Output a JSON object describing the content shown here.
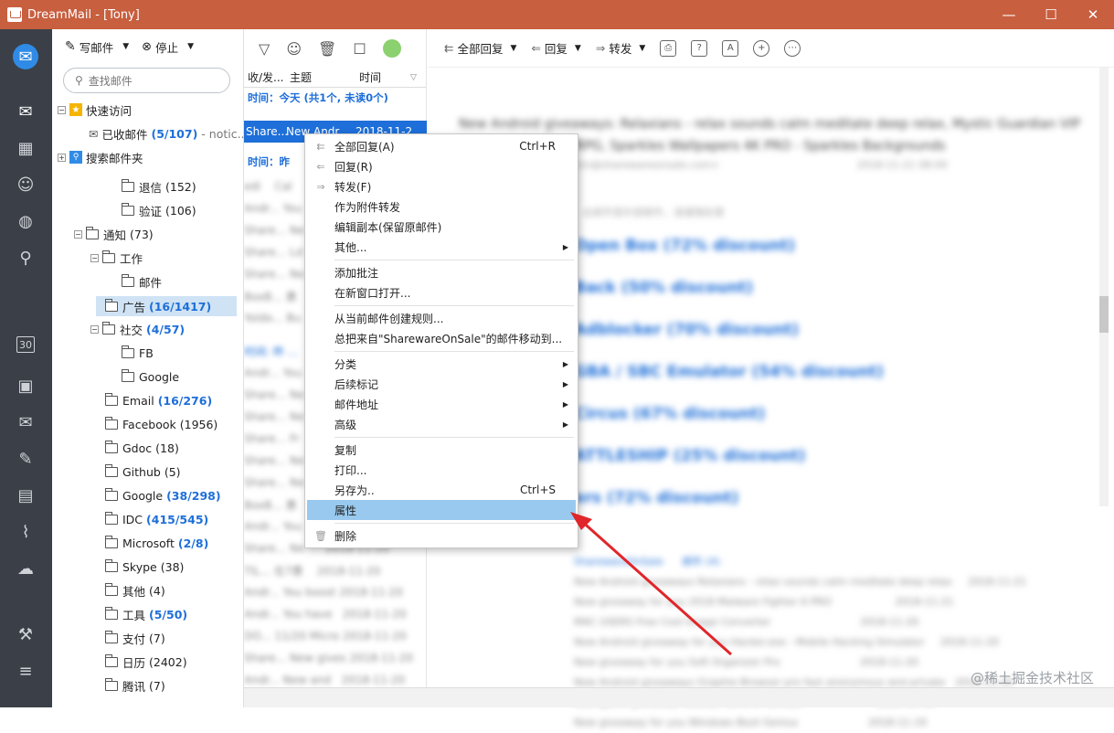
{
  "window": {
    "title": "DreamMail - [Tony]",
    "controls": [
      "—",
      "☐",
      "✕"
    ]
  },
  "leftRail": {
    "icons": [
      "mailbox-logo-icon",
      "mail-icon",
      "calendar-grid-icon",
      "contacts-icon",
      "globe-icon",
      "search-icon",
      "calendar-30-icon",
      "address-card-icon",
      "mail-send-icon",
      "pen-icon",
      "document-icon",
      "attachment-icon",
      "cloud-icon",
      "wrench-icon",
      "menu-icon"
    ],
    "calendarDay": "30"
  },
  "folderToolbar": {
    "compose": "写邮件",
    "stop": "停止"
  },
  "search": {
    "placeholder": "查找邮件"
  },
  "tree": {
    "quickAccess": "快速访问",
    "received": {
      "name": "已收邮件",
      "count": "(5/107)",
      "extra": "- notic..."
    },
    "searchFolders": "搜索邮件夹",
    "bounce": {
      "name": "退信",
      "count": "(152)"
    },
    "verify": {
      "name": "验证",
      "count": "(106)"
    },
    "notice": {
      "name": "通知",
      "count": "(73)"
    },
    "work": {
      "name": "工作"
    },
    "mail": {
      "name": "邮件"
    },
    "ads": {
      "name": "广告",
      "count": "(16/1417)"
    },
    "social": {
      "name": "社交",
      "count": "(4/57)"
    },
    "fb": {
      "name": "FB"
    },
    "google1": {
      "name": "Google"
    },
    "email": {
      "name": "Email",
      "count": "(16/276)"
    },
    "facebook": {
      "name": "Facebook",
      "count": "(1956)"
    },
    "gdoc": {
      "name": "Gdoc",
      "count": "(18)"
    },
    "github": {
      "name": "Github",
      "count": "(5)"
    },
    "google2": {
      "name": "Google",
      "count": "(38/298)"
    },
    "idc": {
      "name": "IDC",
      "count": "(415/545)"
    },
    "microsoft": {
      "name": "Microsoft",
      "count": "(2/8)"
    },
    "skype": {
      "name": "Skype",
      "count": "(38)"
    },
    "other": {
      "name": "其他",
      "count": "(4)"
    },
    "tools": {
      "name": "工具",
      "count": "(5/50)"
    },
    "pay": {
      "name": "支付",
      "count": "(7)"
    },
    "calendar": {
      "name": "日历",
      "count": "(2402)"
    },
    "tencent": {
      "name": "腾讯",
      "count": "(7)"
    }
  },
  "mailList": {
    "columns": {
      "sender": "收/发...",
      "subject": "主题",
      "time": "时间"
    },
    "groupToday": "时间：今天 (共1个, 未读0个)",
    "groupYesterday": "时间：昨",
    "selected": {
      "sender": "Share...",
      "subject": "New Andr...",
      "time": "2018-11-2..."
    }
  },
  "readToolbar": {
    "replyAll": "全部回复",
    "reply": "回复",
    "forward": "转发"
  },
  "contextMenu": {
    "items": [
      {
        "label": "全部回复(A)",
        "shortcut": "Ctrl+R"
      },
      {
        "label": "回复(R)",
        "shortcut": ""
      },
      {
        "label": "转发(F)",
        "shortcut": ""
      },
      {
        "label": "作为附件转发",
        "shortcut": ""
      },
      {
        "label": "编辑副本(保留原邮件)",
        "shortcut": ""
      },
      {
        "label": "其他...",
        "shortcut": ""
      },
      {
        "label": "添加批注",
        "shortcut": ""
      },
      {
        "label": "在新窗口打开...",
        "shortcut": ""
      },
      {
        "label": "从当前邮件创建规则...",
        "shortcut": ""
      },
      {
        "label": "总把来自\"SharewareOnSale\"的邮件移动到...",
        "shortcut": ""
      },
      {
        "label": "分类",
        "shortcut": ""
      },
      {
        "label": "后续标记",
        "shortcut": ""
      },
      {
        "label": "邮件地址",
        "shortcut": ""
      },
      {
        "label": "高级",
        "shortcut": ""
      },
      {
        "label": "复制",
        "shortcut": ""
      },
      {
        "label": "打印...",
        "shortcut": ""
      },
      {
        "label": "另存为..",
        "shortcut": "Ctrl+S"
      },
      {
        "label": "属性",
        "shortcut": ""
      },
      {
        "label": "删除",
        "shortcut": ""
      }
    ]
  },
  "watermark": "@稀土掘金技术社区",
  "colors": {
    "titlebar": "#c85f3f",
    "rail": "#3b4048",
    "accent": "#1e6fd9",
    "menuHighlight": "#99c9ee",
    "arrow": "#e0262a"
  }
}
